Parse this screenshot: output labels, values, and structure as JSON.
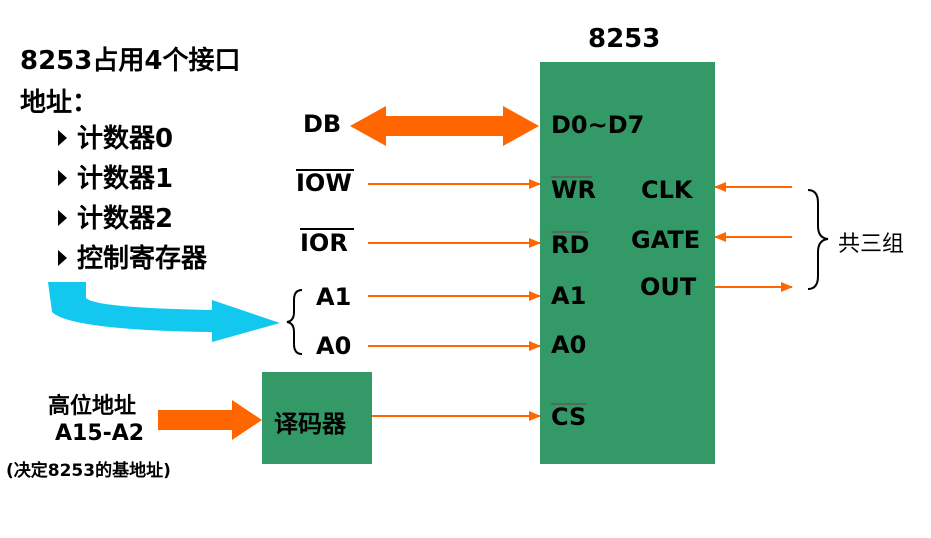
{
  "intro": {
    "line1": "8253占用4个接口",
    "line2": "地址：",
    "items": [
      "计数器0",
      "计数器1",
      "计数器2",
      "控制寄存器"
    ]
  },
  "chip": {
    "title": "8253",
    "pins_left": [
      "D0~D7",
      "WR",
      "RD",
      "A1",
      "A0",
      "CS"
    ],
    "pins_right": [
      "CLK",
      "GATE",
      "OUT"
    ]
  },
  "signals": {
    "db": "DB",
    "iow": "IOW",
    "ior": "IOR",
    "a1": "A1",
    "a0": "A0"
  },
  "decoder": {
    "label": "译码器"
  },
  "high_addr": {
    "line1": "高位地址",
    "line2": "A15-A2",
    "line3": "(决定8253的基地址)"
  },
  "group_label": "共三组",
  "colors": {
    "chip": "#339966",
    "arrow": "#ff6600",
    "cyan": "#00ccff"
  }
}
